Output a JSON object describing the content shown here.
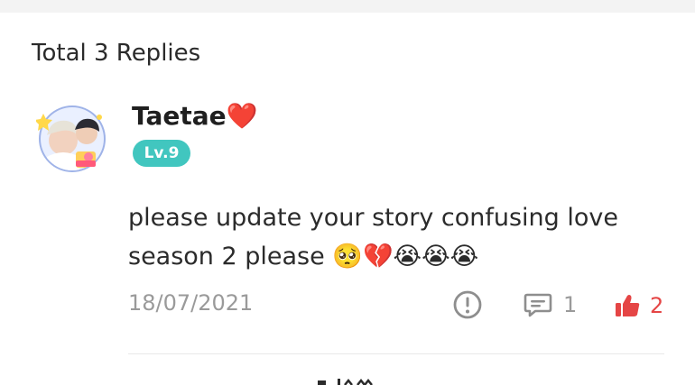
{
  "header": {
    "replies_label": "Total 3 Replies"
  },
  "reply": {
    "username": "Taetae",
    "username_emoji": "❤️",
    "level": "Lv.9",
    "text_line1": "please update your story confusing love",
    "text_line2": "season 2 please 🥺💔😭😭😭",
    "date": "18/07/2021",
    "comment_count": "1",
    "like_count": "2"
  },
  "icons": {
    "report": "exclamation-circle-icon",
    "comment": "comment-bubble-icon",
    "like": "thumbs-up-icon"
  },
  "colors": {
    "level_badge": "#41c6bf",
    "like_active": "#e54545",
    "muted_text": "#9a9a9a"
  }
}
